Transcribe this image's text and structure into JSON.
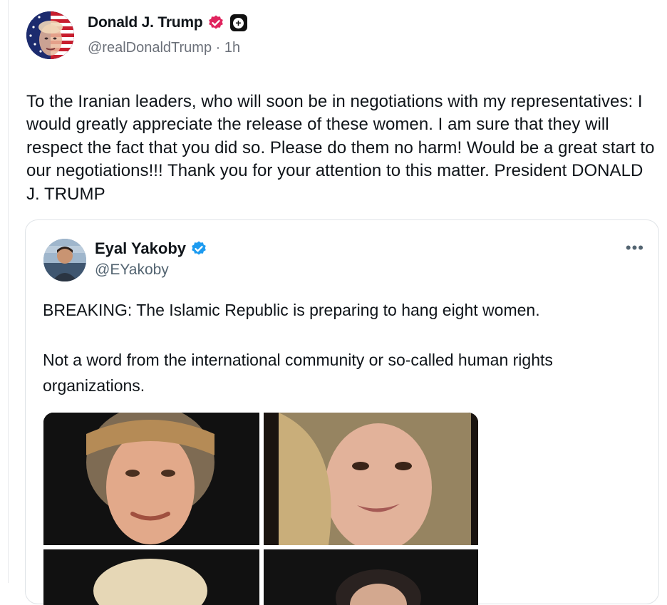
{
  "author": {
    "display_name": "Donald J. Trump",
    "handle": "@realDonaldTrump",
    "separator": "·",
    "time_ago": "1h",
    "verified_badge_color": "#e0245e",
    "extra_badge_icon": "plus-badge-icon"
  },
  "post": {
    "text": "To the Iranian leaders, who will soon be in negotiations with my representatives: I would greatly appreciate the release of these women. I am sure that they will respect the fact that you did so. Please do them no harm! Would be a great start to our negotiations!!! Thank you for your attention to this matter. President DONALD J. TRUMP"
  },
  "quoted": {
    "display_name": "Eyal Yakoby",
    "handle": "@EYakoby",
    "verified_badge_color": "#1d9bf0",
    "more_label": "•••",
    "paragraphs": [
      "BREAKING: The Islamic Republic is preparing to hang eight women.",
      "Not a word from the international community or so-called human rights organizations."
    ]
  },
  "colors": {
    "text_primary": "#0f1419",
    "text_secondary": "#536471",
    "border": "#dfe3e7"
  }
}
